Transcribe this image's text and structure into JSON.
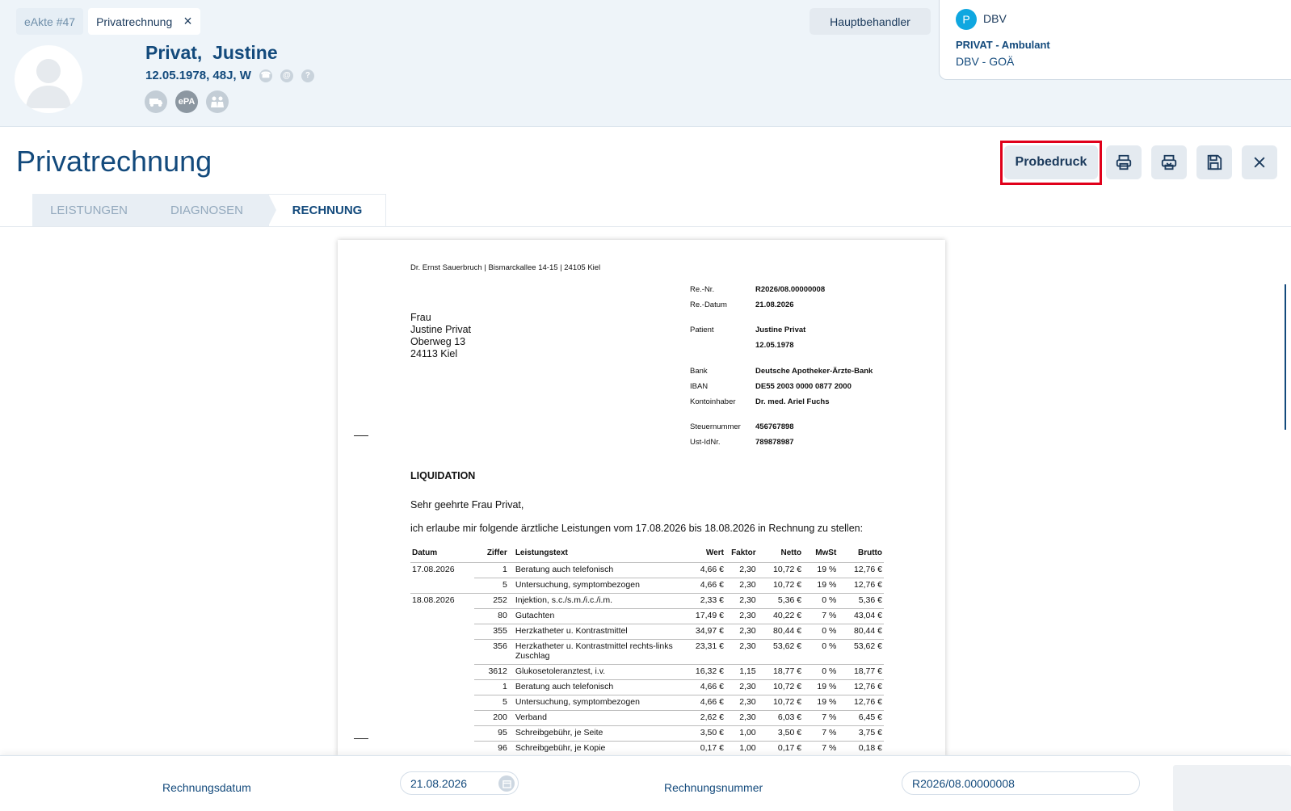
{
  "tabs": [
    {
      "label": "eAkte #47"
    },
    {
      "label": "Privatrechnung"
    }
  ],
  "patient": {
    "name": "Privat,  Justine",
    "info": "12.05.1978, 48J, W",
    "badges": {
      "epa": "ePA"
    }
  },
  "header": {
    "hauptbehandler": "Hauptbehandler"
  },
  "insurance": {
    "initial": "P",
    "name": "DBV",
    "type": "PRIVAT - Ambulant",
    "tariff": "DBV - GOÄ"
  },
  "page": {
    "title": "Privatrechnung"
  },
  "toolbar": {
    "probedruck": "Probedruck",
    "icons": [
      "print-icon",
      "print-preview-icon",
      "save-icon",
      "close-icon"
    ]
  },
  "steps": [
    "LEISTUNGEN",
    "DIAGNOSEN",
    "RECHNUNG"
  ],
  "document": {
    "sender": "Dr. Ernst Sauerbruch | Bismarckallee 14-15 | 24105 Kiel",
    "address": [
      "Frau",
      "Justine Privat",
      "Oberweg 13",
      "24113 Kiel"
    ],
    "info": [
      {
        "label": "Re.-Nr.",
        "value": "R2026/08.00000008"
      },
      {
        "label": "Re.-Datum",
        "value": "21.08.2026"
      },
      {
        "label": "Patient",
        "value": "Justine Privat"
      },
      {
        "label": "",
        "value": "12.05.1978"
      },
      {
        "label": "Bank",
        "value": "Deutsche Apotheker-Ärzte-Bank"
      },
      {
        "label": "IBAN",
        "value": "DE55 2003 0000 0877 2000"
      },
      {
        "label": "Kontoinhaber",
        "value": "Dr. med. Ariel Fuchs"
      },
      {
        "label": "Steuernummer",
        "value": "456767898"
      },
      {
        "label": "Ust-IdNr.",
        "value": "789878987"
      }
    ],
    "heading": "LIQUIDATION",
    "greeting": "Sehr geehrte Frau Privat,",
    "intro": "ich erlaube mir folgende ärztliche Leistungen vom 17.08.2026 bis 18.08.2026 in Rechnung zu stellen:",
    "columns": [
      "Datum",
      "Ziffer",
      "Leistungstext",
      "Wert",
      "Faktor",
      "Netto",
      "MwSt",
      "Brutto"
    ],
    "rows": [
      [
        "17.08.2026",
        "1",
        "Beratung auch telefonisch",
        "4,66 €",
        "2,30",
        "10,72 €",
        "19 %",
        "12,76 €"
      ],
      [
        "",
        "5",
        "Untersuchung, symptombezogen",
        "4,66 €",
        "2,30",
        "10,72 €",
        "19 %",
        "12,76 €"
      ],
      [
        "18.08.2026",
        "252",
        "Injektion, s.c./s.m./i.c./i.m.",
        "2,33 €",
        "2,30",
        "5,36 €",
        "0 %",
        "5,36 €"
      ],
      [
        "",
        "80",
        "Gutachten",
        "17,49 €",
        "2,30",
        "40,22 €",
        "7 %",
        "43,04 €"
      ],
      [
        "",
        "355",
        "Herzkatheter u. Kontrastmittel",
        "34,97 €",
        "2,30",
        "80,44 €",
        "0 %",
        "80,44 €"
      ],
      [
        "",
        "356",
        "Herzkatheter u. Kontrastmittel rechts-links Zuschlag",
        "23,31 €",
        "2,30",
        "53,62 €",
        "0 %",
        "53,62 €"
      ],
      [
        "",
        "3612",
        "Glukosetoleranztest, i.v.",
        "16,32 €",
        "1,15",
        "18,77 €",
        "0 %",
        "18,77 €"
      ],
      [
        "",
        "1",
        "Beratung auch telefonisch",
        "4,66 €",
        "2,30",
        "10,72 €",
        "19 %",
        "12,76 €"
      ],
      [
        "",
        "5",
        "Untersuchung, symptombezogen",
        "4,66 €",
        "2,30",
        "10,72 €",
        "19 %",
        "12,76 €"
      ],
      [
        "",
        "200",
        "Verband",
        "2,62 €",
        "2,30",
        "6,03 €",
        "7 %",
        "6,45 €"
      ],
      [
        "",
        "95",
        "Schreibgebühr, je Seite",
        "3,50 €",
        "1,00",
        "3,50 €",
        "7 %",
        "3,75 €"
      ],
      [
        "",
        "96",
        "Schreibgebühr, je Kopie",
        "0,17 €",
        "1,00",
        "0,17 €",
        "7 %",
        "0,18 €"
      ]
    ]
  },
  "footer": {
    "date_label": "Rechnungsdatum",
    "date_value": "21.08.2026",
    "number_label": "Rechnungsnummer",
    "number_value": "R2026/08.00000008"
  }
}
